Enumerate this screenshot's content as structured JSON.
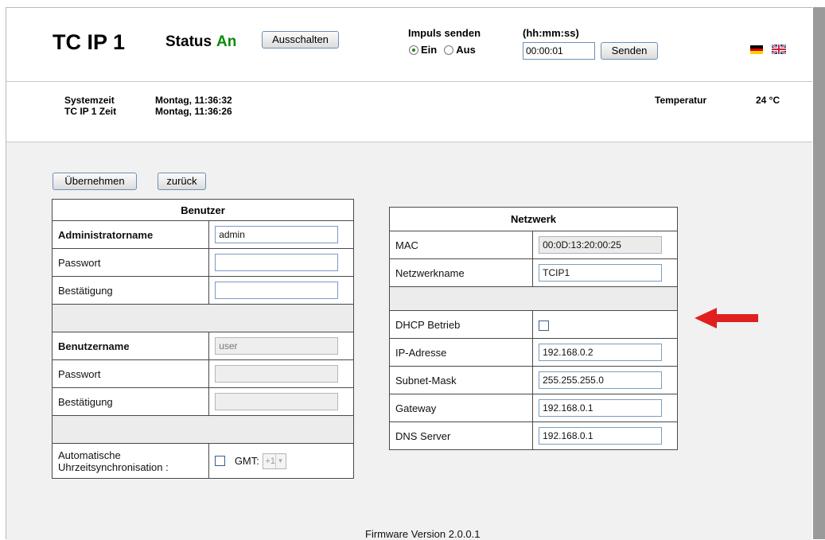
{
  "header": {
    "device_title": "TC IP 1",
    "status_label": "Status",
    "status_value": "An",
    "off_button": "Ausschalten",
    "impulse_label": "Impuls senden",
    "radio_on_label": "Ein",
    "radio_off_label": "Aus",
    "radio_selected": "Ein",
    "time_format_label": "(hh:mm:ss)",
    "time_value": "00:00:01",
    "send_button": "Senden",
    "languages": [
      "de-flag-icon",
      "uk-flag-icon"
    ]
  },
  "system": {
    "systemzeit_label": "Systemzeit",
    "systemzeit_value": "Montag, 11:36:32",
    "device_time_label": "TC IP 1 Zeit",
    "device_time_value": "Montag, 11:36:26",
    "temperature_label": "Temperatur",
    "temperature_value": "24 °C"
  },
  "actions": {
    "apply_button": "Übernehmen",
    "back_button": "zurück"
  },
  "benutzer": {
    "title": "Benutzer",
    "admin_name_label": "Administratorname",
    "admin_name_value": "admin",
    "admin_password_label": "Passwort",
    "admin_confirm_label": "Bestätigung",
    "user_name_label": "Benutzername",
    "user_name_placeholder": "user",
    "user_password_label": "Passwort",
    "user_confirm_label": "Bestätigung",
    "auto_sync_label_line1": "Automatische",
    "auto_sync_label_line2": "Uhrzeitsynchronisation :",
    "gmt_label": "GMT:",
    "gmt_value": "+1"
  },
  "netzwerk": {
    "title": "Netzwerk",
    "mac_label": "MAC",
    "mac_value": "00:0D:13:20:00:25",
    "netname_label": "Netzwerkname",
    "netname_value": "TCIP1",
    "dhcp_label": "DHCP Betrieb",
    "ip_label": "IP-Adresse",
    "ip_value": "192.168.0.2",
    "subnet_label": "Subnet-Mask",
    "subnet_value": "255.255.255.0",
    "gateway_label": "Gateway",
    "gateway_value": "192.168.0.1",
    "dns_label": "DNS Server",
    "dns_value": "192.168.0.1"
  },
  "annotation": {
    "arrow_color": "#e02020"
  },
  "footer": {
    "firmware": "Firmware Version 2.0.0.1"
  }
}
